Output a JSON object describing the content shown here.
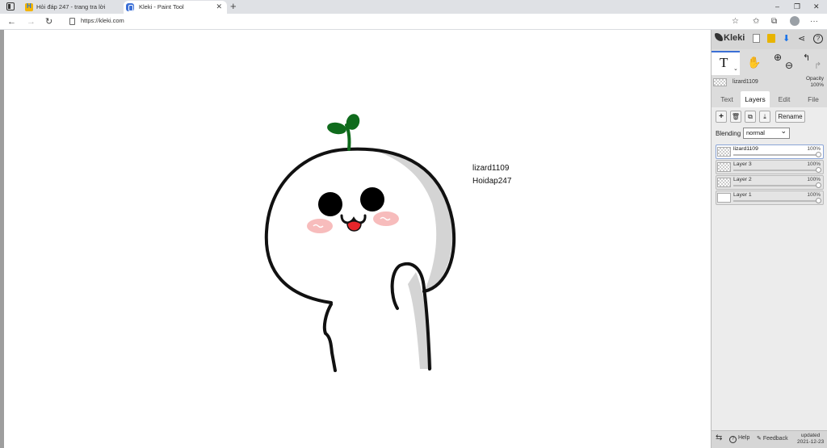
{
  "browser": {
    "tabs": [
      {
        "title": "Hỏi đáp 247 - trang tra lời"
      },
      {
        "title": "Kleki - Paint Tool"
      }
    ],
    "url": "https://kleki.com",
    "new_tab_symbol": "+",
    "close_symbol": "✕",
    "window_controls": [
      "–",
      "❐",
      "✕"
    ],
    "nav": {
      "back": "←",
      "forward": "→",
      "reload": "↻"
    },
    "toolbar_icons": [
      "tab-search-icon",
      "favorites-icon",
      "collections-icon",
      "profile-avatar",
      "more-icon"
    ],
    "toolbar_glyphs": {
      "favorites_add": "☆",
      "favorites": "✩",
      "collections": "⧉",
      "more": "···"
    }
  },
  "canvas": {
    "signature_line1": "lizard1109",
    "signature_line2": "Hoidap247",
    "colors": {
      "sprout": "#0f6b1c",
      "blush": "#f4a6a6",
      "tongue": "#e8252a",
      "shade": "#d4d4d4"
    }
  },
  "panel": {
    "logo": "Kleki",
    "top_glyphs": {
      "share": "⋖",
      "help": "?",
      "download": "⬇"
    },
    "tool_label": "T",
    "tool_chevron": "⌄",
    "zoom_glyphs": {
      "zoom_in": "⊕",
      "zoom_out": "⊖"
    },
    "undo_glyphs": {
      "undo": "↰",
      "redo": "↱"
    },
    "hand_glyph": "✋",
    "current_layer": {
      "name": "lizard1109",
      "opacity_label": "Opacity",
      "opacity": "100%"
    },
    "tabs": [
      "Text",
      "Layers",
      "Edit",
      "File"
    ],
    "active_tab": "Layers",
    "layer_buttons": {
      "add": "+",
      "delete": "🗑",
      "duplicate": "⧉",
      "merge": "⤓",
      "rename": "Rename"
    },
    "blending_label": "Blending",
    "blending_value": "normal",
    "layers": [
      {
        "name": "lizard1109",
        "opacity": "100%",
        "selected": true
      },
      {
        "name": "Layer 3",
        "opacity": "100%",
        "selected": false
      },
      {
        "name": "Layer 2",
        "opacity": "100%",
        "selected": false
      },
      {
        "name": "Layer 1",
        "opacity": "100%",
        "selected": false
      }
    ],
    "footer": {
      "swap_glyph": "⇆",
      "help": "Help",
      "feedback": "Feedback",
      "updated_label": "updated",
      "updated_date": "2021-12-23"
    }
  }
}
